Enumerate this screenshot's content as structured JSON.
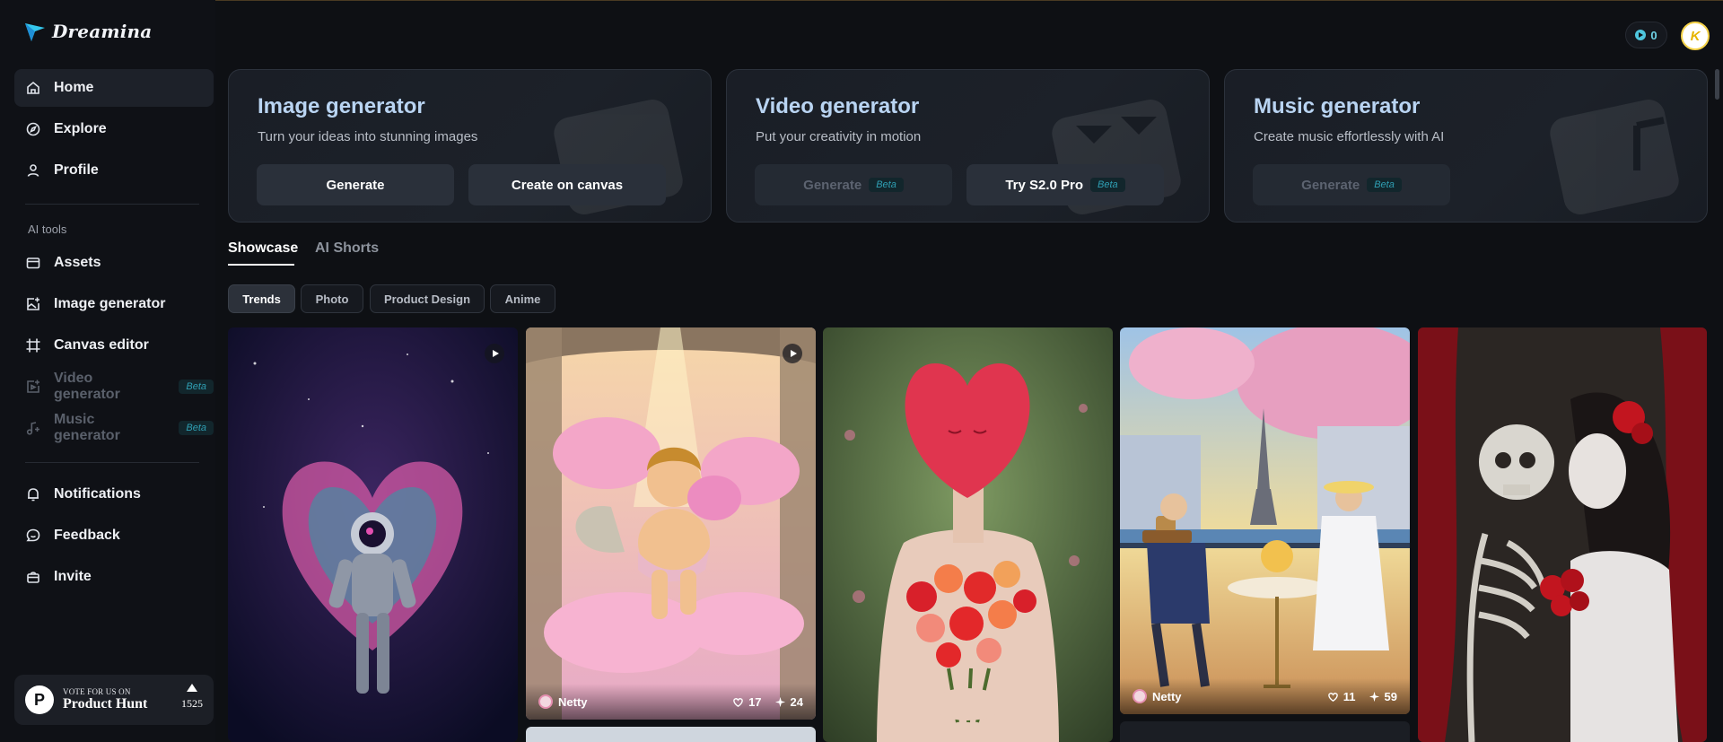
{
  "brand": {
    "name": "Dreamina"
  },
  "sidebar": {
    "primary": [
      {
        "label": "Home",
        "icon": "home-icon"
      },
      {
        "label": "Explore",
        "icon": "compass-icon"
      },
      {
        "label": "Profile",
        "icon": "user-icon"
      }
    ],
    "section_label": "AI tools",
    "tools": [
      {
        "label": "Assets",
        "icon": "folder-icon"
      },
      {
        "label": "Image generator",
        "icon": "image-plus-icon"
      },
      {
        "label": "Canvas editor",
        "icon": "canvas-icon"
      },
      {
        "label": "Video generator",
        "icon": "video-plus-icon",
        "badge": "Beta"
      },
      {
        "label": "Music generator",
        "icon": "music-plus-icon",
        "badge": "Beta"
      }
    ],
    "secondary": [
      {
        "label": "Notifications",
        "icon": "bell-icon"
      },
      {
        "label": "Feedback",
        "icon": "chat-icon"
      },
      {
        "label": "Invite",
        "icon": "gift-icon"
      }
    ],
    "product_hunt": {
      "vote_text": "VOTE FOR US ON",
      "name": "Product Hunt",
      "count": "1525",
      "logo_letter": "P"
    }
  },
  "header": {
    "credits": "0",
    "avatar_letter": "K"
  },
  "generators": [
    {
      "title": "Image generator",
      "subtitle": "Turn your ideas into stunning images",
      "buttons": [
        {
          "label": "Generate"
        },
        {
          "label": "Create on canvas"
        }
      ]
    },
    {
      "title": "Video generator",
      "subtitle": "Put your creativity in motion",
      "buttons": [
        {
          "label": "Generate",
          "badge": "Beta"
        },
        {
          "label": "Try S2.0 Pro",
          "badge": "Beta"
        }
      ]
    },
    {
      "title": "Music generator",
      "subtitle": "Create music effortlessly with AI",
      "buttons": [
        {
          "label": "Generate",
          "badge": "Beta"
        }
      ]
    }
  ],
  "tabs": [
    {
      "label": "Showcase"
    },
    {
      "label": "AI Shorts"
    }
  ],
  "filters": [
    {
      "label": "Trends"
    },
    {
      "label": "Photo"
    },
    {
      "label": "Product Design"
    },
    {
      "label": "Anime"
    }
  ],
  "gallery": [
    {
      "subject": "astronaut in heart nebula"
    },
    {
      "subject": "cherub on pink clouds",
      "user": "Netty",
      "likes": "17",
      "remixes": "24"
    },
    {
      "subject": "heart-headed figure with bouquet"
    },
    {
      "subject": "couple at Paris cafe",
      "user": "Netty",
      "likes": "11",
      "remixes": "59"
    },
    {
      "subject": "skeleton and bride with roses"
    }
  ],
  "colors": {
    "accent": "#b9d4f2",
    "beta": "#2f9fb3",
    "background": "#0e1014"
  }
}
